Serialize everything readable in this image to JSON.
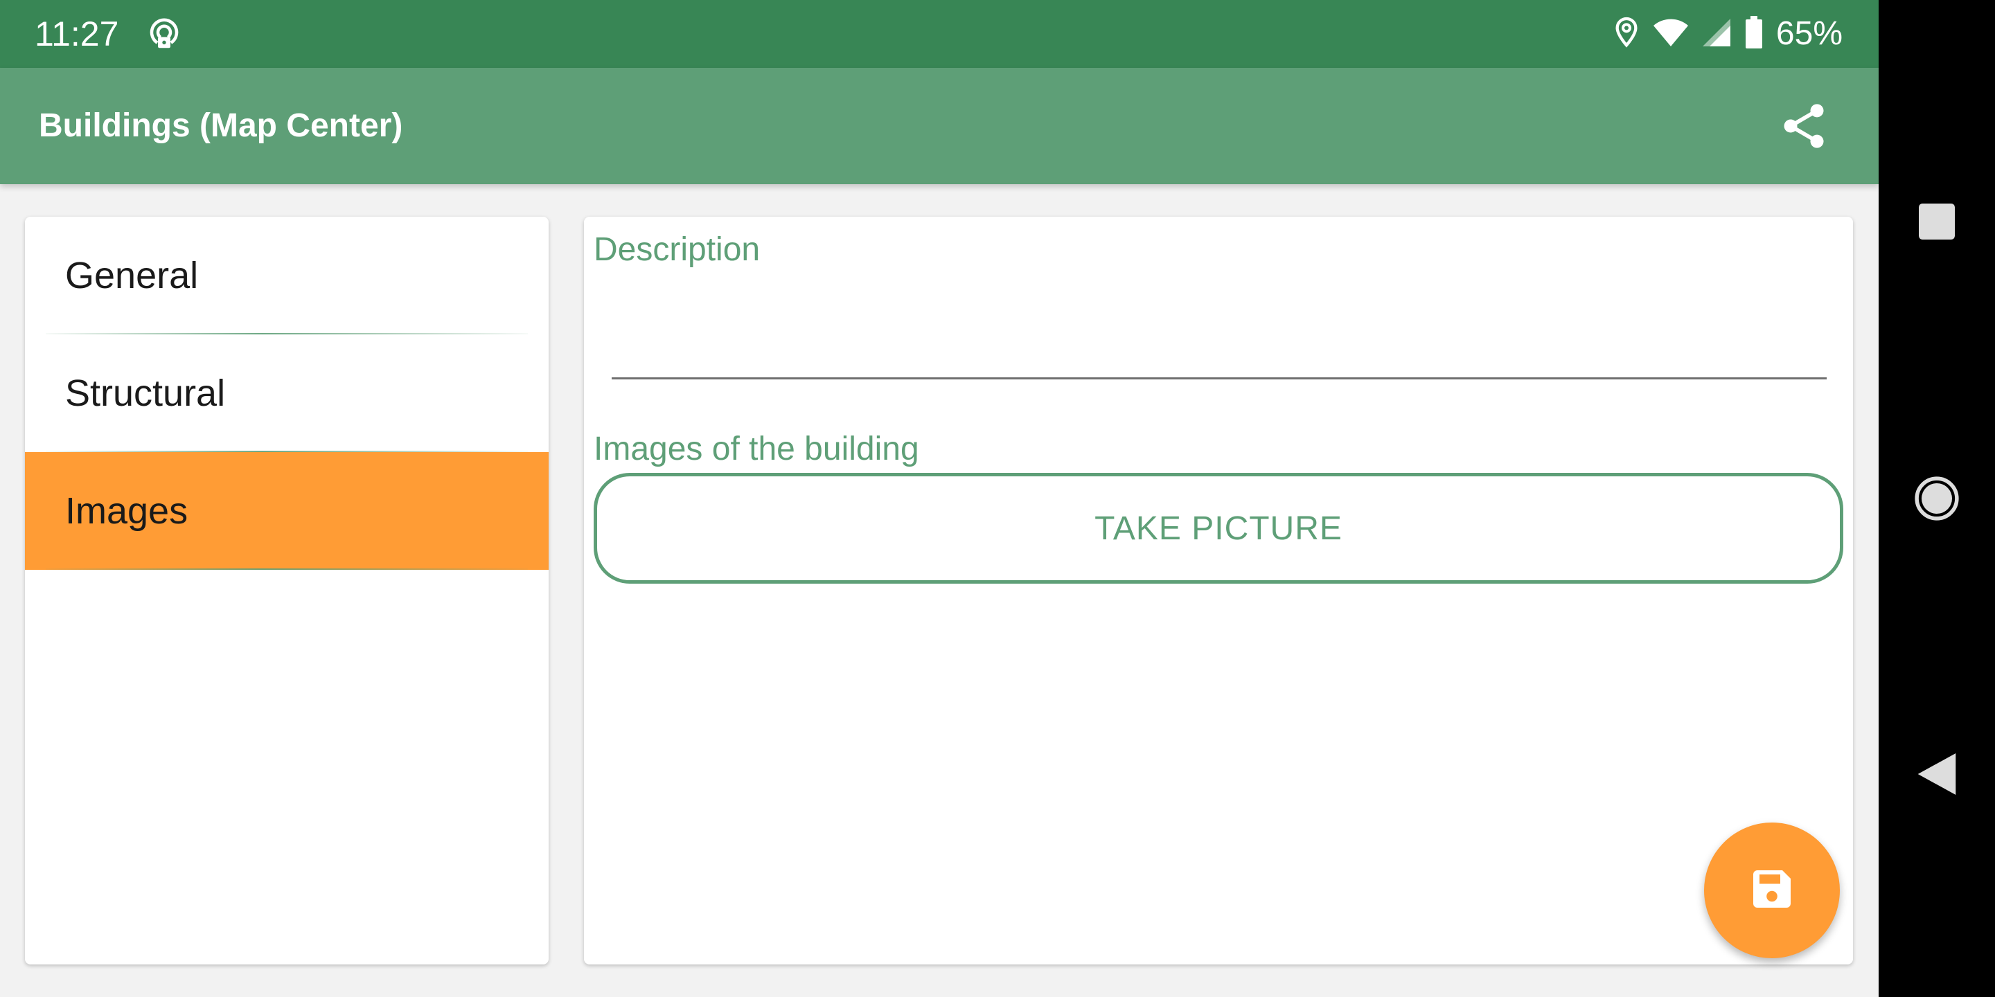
{
  "status_bar": {
    "time": "11:27",
    "battery_percent": "65%",
    "icons": [
      "hotspot-icon",
      "location-icon",
      "wifi-icon",
      "signal-icon",
      "battery-icon"
    ]
  },
  "app_bar": {
    "title": "Buildings (Map Center)",
    "action_icon": "share-icon"
  },
  "sidebar": {
    "tabs": [
      {
        "label": "General",
        "active": false
      },
      {
        "label": "Structural",
        "active": false
      },
      {
        "label": "Images",
        "active": true
      }
    ]
  },
  "form": {
    "description_label": "Description",
    "description_value": "",
    "images_label": "Images of the building",
    "take_picture_label": "TAKE PICTURE"
  },
  "fab": {
    "icon": "save-icon"
  },
  "navigation_bar": {
    "buttons": [
      "recents-icon",
      "home-icon",
      "back-icon"
    ]
  },
  "colors": {
    "status_bar": "#388655",
    "app_bar": "#5e9f77",
    "accent_orange": "#ff9c35",
    "accent_green": "#5e9f77"
  }
}
